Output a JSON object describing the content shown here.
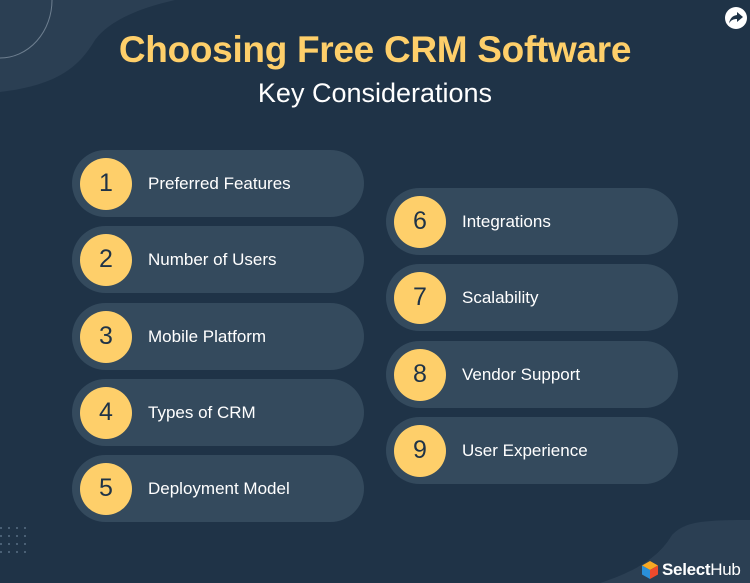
{
  "header": {
    "title": "Choosing Free CRM Software",
    "subtitle": "Key Considerations"
  },
  "share_button": {
    "icon": "share-arrow-icon"
  },
  "considerations": {
    "left_column": [
      {
        "number": "1",
        "label": "Preferred Features"
      },
      {
        "number": "2",
        "label": "Number of Users"
      },
      {
        "number": "3",
        "label": "Mobile Platform"
      },
      {
        "number": "4",
        "label": "Types of CRM"
      },
      {
        "number": "5",
        "label": "Deployment Model"
      }
    ],
    "right_column": [
      {
        "number": "6",
        "label": "Integrations"
      },
      {
        "number": "7",
        "label": "Scalability"
      },
      {
        "number": "8",
        "label": "Vendor Support"
      },
      {
        "number": "9",
        "label": "User Experience"
      }
    ]
  },
  "brand": {
    "name_bold": "Select",
    "name_light": "Hub",
    "icon": "selecthub-cube-logo-icon"
  },
  "colors": {
    "background": "#1f3347",
    "pill": "#344a5d",
    "accent_yellow": "#fecf6a",
    "text_white": "#ffffff"
  }
}
